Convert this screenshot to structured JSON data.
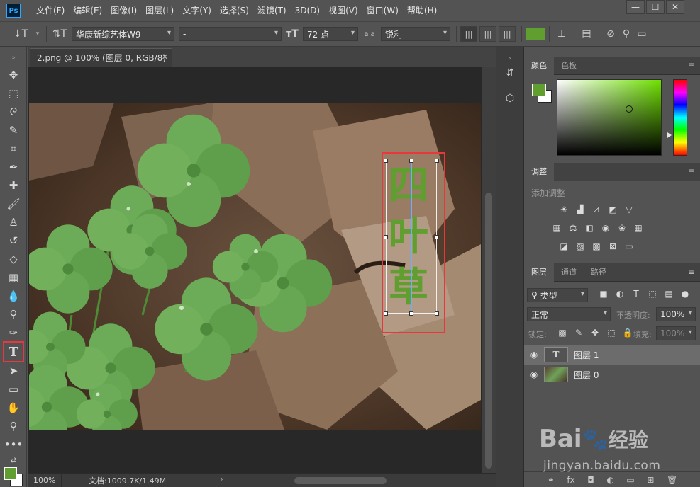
{
  "app": {
    "logo_text": "Ps",
    "menu": [
      "文件(F)",
      "编辑(E)",
      "图像(I)",
      "图层(L)",
      "文字(Y)",
      "选择(S)",
      "滤镜(T)",
      "3D(D)",
      "视图(V)",
      "窗口(W)",
      "帮助(H)"
    ],
    "window_controls": {
      "minimize": "—",
      "maximize": "☐",
      "close": "✕"
    }
  },
  "options": {
    "font_family": "华康新综艺体W9",
    "font_style": "-",
    "font_size": "72 点",
    "aa_label": "a a",
    "antialias": "锐利",
    "text_color": "#5f9e2f"
  },
  "document": {
    "tab_title": "2.png @ 100% (图层 0, RGB/8)",
    "tab_close": "✕",
    "zoom": "100%",
    "doc_size": "文档:1009.7K/1.49M",
    "vertical_text": [
      "四",
      "叶",
      "草"
    ]
  },
  "panels": {
    "color": {
      "tabs": [
        "颜色",
        "色板"
      ],
      "fg": "#5f9e2f",
      "bg": "#ffffff"
    },
    "adjustments": {
      "tab": "调整",
      "hint": "添加调整"
    },
    "layers": {
      "tabs": [
        "图层",
        "通道",
        "路径"
      ],
      "filter_label": "类型",
      "blend_mode": "正常",
      "opacity_label": "不透明度:",
      "opacity_value": "100%",
      "lock_label": "锁定:",
      "fill_label": "填充:",
      "fill_value": "100%",
      "items": [
        {
          "name": "图层 1",
          "thumb": "T",
          "selected": true
        },
        {
          "name": "图层 0",
          "thumb": "",
          "selected": false
        }
      ]
    }
  },
  "watermark": {
    "brand": "Bai",
    "brand2": "经验",
    "site": "jingyan.baidu.com"
  },
  "accent": "#e8383d"
}
